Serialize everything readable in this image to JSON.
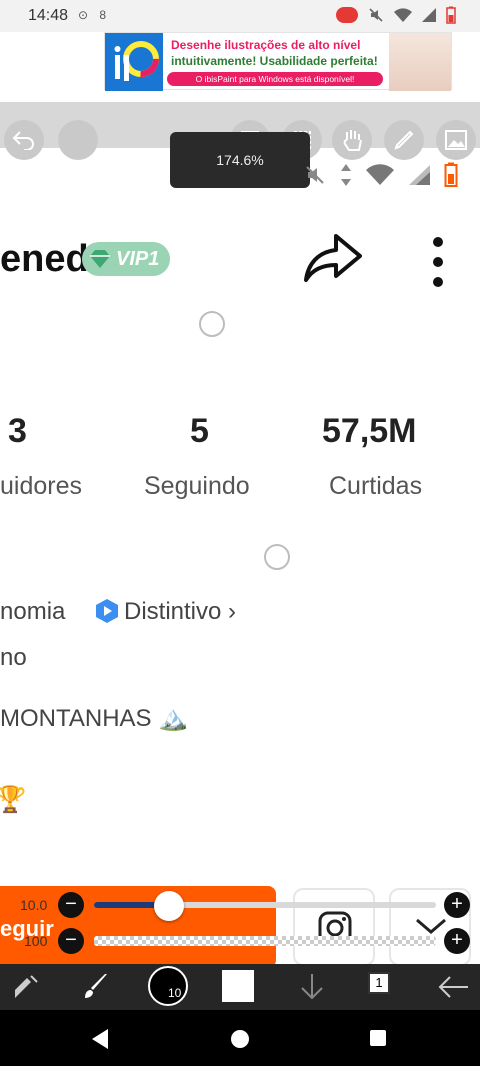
{
  "status_bar": {
    "time": "14:48",
    "left_icons": "⊙ 8"
  },
  "ad": {
    "line1": "Desenhe ilustrações de alto nível",
    "line2": "intuitivamente! Usabilidade perfeita!",
    "pill": "O ibisPaint para Windows está disponível!"
  },
  "zoom": {
    "label": "174.6%"
  },
  "profile": {
    "name_partial": "ened",
    "vip_badge": "VIP1"
  },
  "stats": [
    {
      "value": "3",
      "label": "uidores"
    },
    {
      "value": "5",
      "label": "Seguindo"
    },
    {
      "value": "57,5M",
      "label": "Curtidas"
    }
  ],
  "bio": {
    "line1_left": "nomia",
    "badge_label": "Distintivo",
    "badge_chevron": "›",
    "line2": "no",
    "line3": "MONTANHAS 🏔️",
    "trophy": "🏆"
  },
  "brush_panel": {
    "button_text": "eguir",
    "size_value": "10.0",
    "opacity_value": "100",
    "size_fraction": 0.22,
    "opacity_fraction": 1.0
  },
  "toolbar": {
    "brush_size_badge": "10",
    "layer_number": "1"
  },
  "icons": {
    "undo": "undo-icon",
    "transform": "transform-icon",
    "hand": "hand-icon",
    "pen": "pen-icon",
    "image": "image-icon",
    "share": "share-arrow-icon",
    "more": "more-vertical-icon"
  },
  "colors": {
    "accent_orange": "#ff5a00",
    "slider_navy": "#1e3a78",
    "vip_green": "#9bd4b4",
    "badge_blue": "#3b8ff0"
  }
}
